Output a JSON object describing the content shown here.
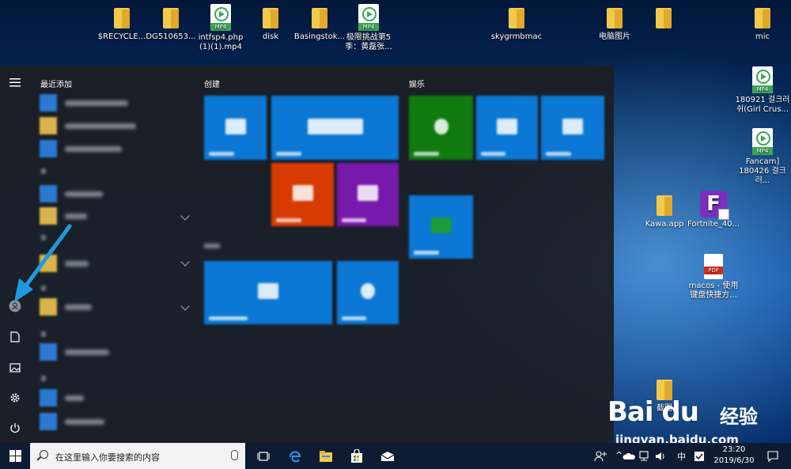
{
  "desktop": {
    "top_icons": [
      {
        "label": "$RECYCLE...",
        "type": "folder"
      },
      {
        "label": "DG510653...",
        "type": "folder"
      },
      {
        "label": "intfsp4.php (1)(1).mp4",
        "type": "mp4"
      },
      {
        "label": "disk",
        "type": "folder"
      },
      {
        "label": "Basingstok...",
        "type": "folder"
      },
      {
        "label": "极限挑战第5季：黄磊张...",
        "type": "mp4"
      },
      {
        "label": "skygrmbmac",
        "type": "folder"
      },
      {
        "label": "电脑图片",
        "type": "folder"
      },
      {
        "label": "",
        "type": "folder"
      },
      {
        "label": "mic",
        "type": "folder"
      }
    ],
    "right_icons": [
      {
        "label": "180921 걸크러쉬(Girl Crus...",
        "type": "mp4"
      },
      {
        "label": "Fancam] 180426 걸크러...",
        "type": "mp4"
      },
      {
        "label": "Kawa.app",
        "type": "folder"
      },
      {
        "label": "Fortnite_40...",
        "type": "fortnite"
      },
      {
        "label": "macos - 使用键盘快捷方...",
        "type": "pdf"
      },
      {
        "label": "截图",
        "type": "folder"
      }
    ],
    "mp4_tag": "MP4",
    "pdf_tag": "PDF"
  },
  "start_menu": {
    "recent_header": "最近添加",
    "create_header": "创建",
    "entertainment_header": "娱乐",
    "rail_icons": [
      "hamburger-menu-icon",
      "user-account-icon",
      "documents-icon",
      "pictures-icon",
      "settings-gear-icon",
      "power-icon"
    ]
  },
  "taskbar": {
    "search_placeholder": "在这里输入你要搜索的内容",
    "ime": "中",
    "time": "23:20",
    "date": "2019/6/30"
  },
  "watermark": {
    "logo": "Bai du",
    "cn": "经验",
    "url": "jingyan.baidu.com"
  },
  "colors": {
    "tile_blue": "#0a78d4",
    "tile_green": "#107c10",
    "tile_orange": "#d83b01",
    "tile_purple": "#7719aa",
    "arrow": "#1e9be0"
  }
}
